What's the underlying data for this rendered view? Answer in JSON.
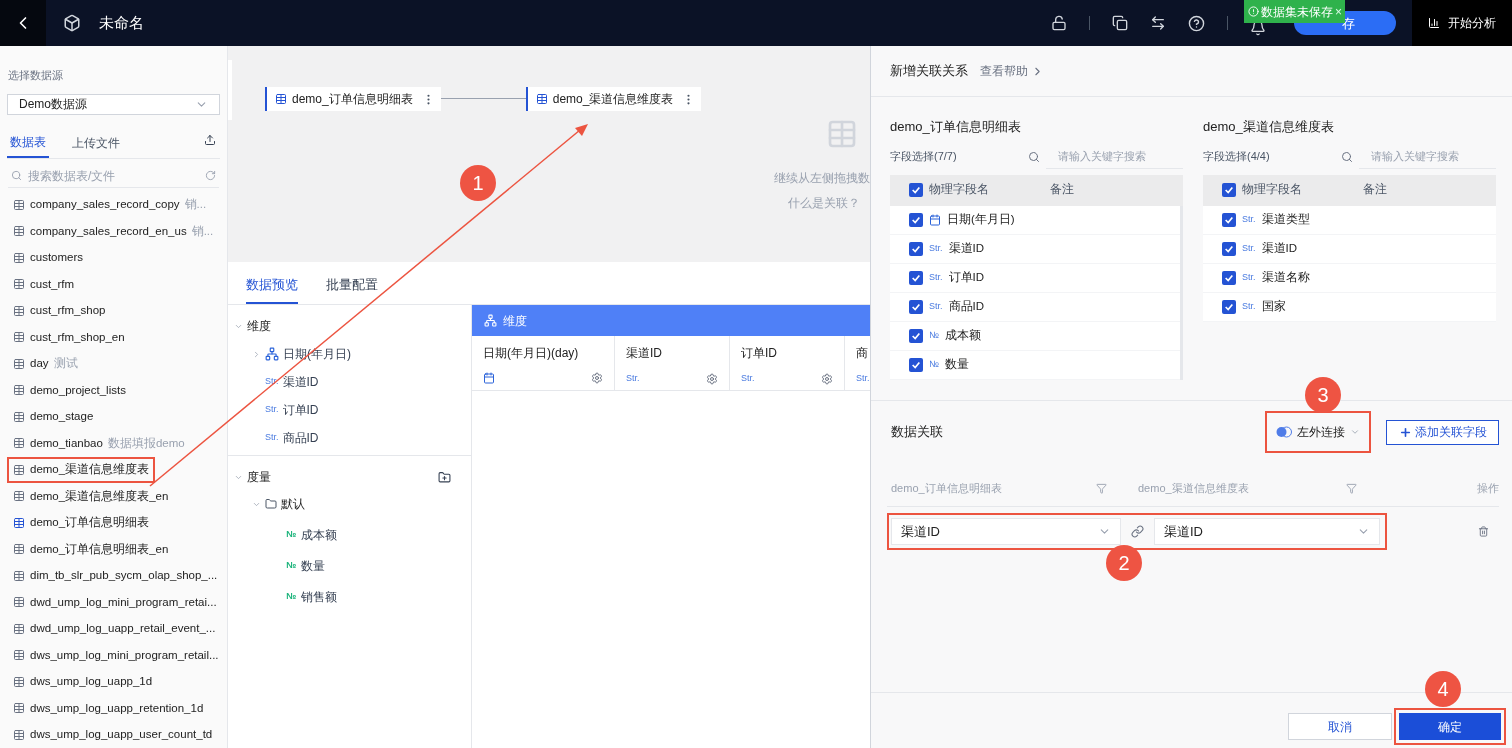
{
  "header": {
    "title": "未命名",
    "toast": {
      "text": "数据集未保存",
      "close": "×"
    },
    "save_button": "存",
    "analyze_button": "开始分析"
  },
  "sidebar": {
    "source_label": "选择数据源",
    "source_select": "Demo数据源",
    "tabs": [
      {
        "label": "数据表",
        "selected": true
      },
      {
        "label": "上传文件",
        "selected": false
      }
    ],
    "search_placeholder": "搜索数据表/文件",
    "tables": [
      {
        "name": "company_sales_record_copy",
        "note": "销...",
        "used": false,
        "highlighted": false
      },
      {
        "name": "company_sales_record_en_us",
        "note": "销...",
        "used": false,
        "highlighted": false
      },
      {
        "name": "customers",
        "used": false,
        "highlighted": false
      },
      {
        "name": "cust_rfm",
        "used": false,
        "highlighted": false
      },
      {
        "name": "cust_rfm_shop",
        "used": false,
        "highlighted": false
      },
      {
        "name": "cust_rfm_shop_en",
        "used": false,
        "highlighted": false
      },
      {
        "name": "day",
        "note": "测试",
        "used": false,
        "highlighted": false
      },
      {
        "name": "demo_project_lists",
        "used": false,
        "highlighted": false
      },
      {
        "name": "demo_stage",
        "used": false,
        "highlighted": false
      },
      {
        "name": "demo_tianbao",
        "note": "数据填报demo",
        "used": false,
        "highlighted": false
      },
      {
        "name": "demo_渠道信息维度表",
        "used": false,
        "highlighted": true
      },
      {
        "name": "demo_渠道信息维度表_en",
        "used": false,
        "highlighted": false
      },
      {
        "name": "demo_订单信息明细表",
        "used": true,
        "highlighted": false
      },
      {
        "name": "demo_订单信息明细表_en",
        "used": false,
        "highlighted": false
      },
      {
        "name": "dim_tb_slr_pub_sycm_olap_shop_...",
        "used": false,
        "highlighted": false
      },
      {
        "name": "dwd_ump_log_mini_program_retai...",
        "used": false,
        "highlighted": false
      },
      {
        "name": "dwd_ump_log_uapp_retail_event_...",
        "used": false,
        "highlighted": false
      },
      {
        "name": "dws_ump_log_mini_program_retail...",
        "used": false,
        "highlighted": false
      },
      {
        "name": "dws_ump_log_uapp_1d",
        "used": false,
        "highlighted": false
      },
      {
        "name": "dws_ump_log_uapp_retention_1d",
        "used": false,
        "highlighted": false
      },
      {
        "name": "dws_ump_log_uapp_user_count_td",
        "used": false,
        "highlighted": false
      }
    ]
  },
  "canvas": {
    "nodes": [
      {
        "name": "demo_订单信息明细表"
      },
      {
        "name": "demo_渠道信息维度表"
      }
    ],
    "hint_lines": [
      "继续从左侧拖拽数",
      "什么是关联？"
    ]
  },
  "preview": {
    "tabs": [
      {
        "label": "数据预览",
        "selected": true
      },
      {
        "label": "批量配置",
        "selected": false
      }
    ],
    "dimensions": {
      "label": "维度",
      "expanded": true,
      "items": [
        {
          "name": "日期(年月日)",
          "kind": "hierarchy",
          "expanded": false
        },
        {
          "name": "渠道ID",
          "kind": "string",
          "type_label": "Str."
        },
        {
          "name": "订单ID",
          "kind": "string",
          "type_label": "Str."
        },
        {
          "name": "商品ID",
          "kind": "string",
          "type_label": "Str."
        }
      ]
    },
    "measures": {
      "label": "度量",
      "expanded": true,
      "folders": [
        {
          "name": "默认",
          "expanded": true,
          "items": [
            {
              "name": "成本额",
              "type_label": "№"
            },
            {
              "name": "数量",
              "type_label": "№"
            },
            {
              "name": "销售额",
              "type_label": "№"
            }
          ]
        }
      ]
    },
    "grid": {
      "group": "维度",
      "columns": [
        {
          "name": "日期(年月日)(day)",
          "kind": "date"
        },
        {
          "name": "渠道ID",
          "kind": "string",
          "type_label": "Str."
        },
        {
          "name": "订单ID",
          "kind": "string",
          "type_label": "Str."
        },
        {
          "name": "商",
          "kind": "string",
          "type_label": "Str."
        }
      ]
    }
  },
  "panel": {
    "title": "新增关联关系",
    "help_link": "查看帮助",
    "tables": [
      {
        "title": "demo_订单信息明细表",
        "count_label": "字段选择(7/7)",
        "search_placeholder": "请输入关键字搜索",
        "columns": [
          "物理字段名",
          "备注"
        ],
        "all_checked": true,
        "fields": [
          {
            "name": "日期(年月日)",
            "kind": "date",
            "checked": true
          },
          {
            "name": "渠道ID",
            "kind": "string",
            "type_label": "Str.",
            "checked": true
          },
          {
            "name": "订单ID",
            "kind": "string",
            "type_label": "Str.",
            "checked": true
          },
          {
            "name": "商品ID",
            "kind": "string",
            "type_label": "Str.",
            "checked": true
          },
          {
            "name": "成本额",
            "kind": "number",
            "type_label": "№",
            "checked": true
          },
          {
            "name": "数量",
            "kind": "number",
            "type_label": "№",
            "checked": true
          }
        ]
      },
      {
        "title": "demo_渠道信息维度表",
        "count_label": "字段选择(4/4)",
        "search_placeholder": "请输入关键字搜索",
        "columns": [
          "物理字段名",
          "备注"
        ],
        "all_checked": true,
        "fields": [
          {
            "name": "渠道类型",
            "kind": "string",
            "type_label": "Str.",
            "checked": true
          },
          {
            "name": "渠道ID",
            "kind": "string",
            "type_label": "Str.",
            "checked": true
          },
          {
            "name": "渠道名称",
            "kind": "string",
            "type_label": "Str.",
            "checked": true
          },
          {
            "name": "国家",
            "kind": "string",
            "type_label": "Str.",
            "checked": true
          }
        ]
      }
    ],
    "join": {
      "title": "数据关联",
      "join_type": {
        "label": "左外连接",
        "highlighted": true
      },
      "add_button": "添加关联字段",
      "columns": [
        "demo_订单信息明细表",
        "demo_渠道信息维度表",
        "操作"
      ],
      "rows": [
        {
          "left": "渠道ID",
          "right": "渠道ID",
          "highlighted": true
        }
      ]
    },
    "cancel_button": "取消",
    "confirm_button": {
      "label": "确定",
      "highlighted": true
    }
  },
  "annotations": [
    {
      "label": "1"
    },
    {
      "label": "2"
    },
    {
      "label": "3"
    },
    {
      "label": "4"
    }
  ]
}
